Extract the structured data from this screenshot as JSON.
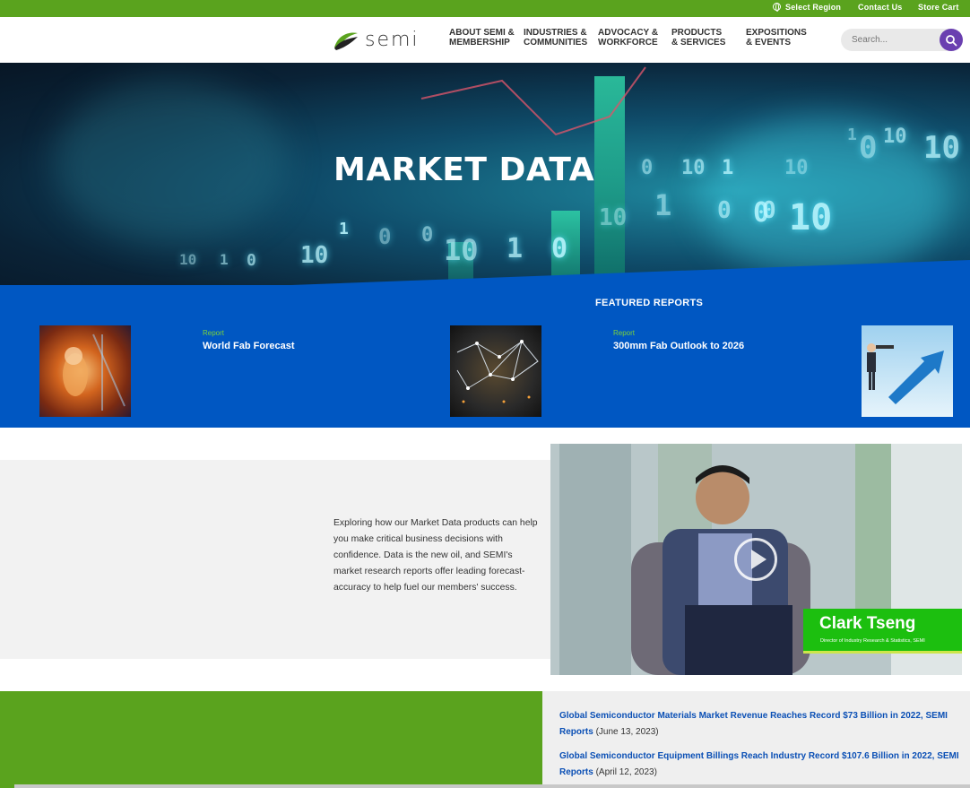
{
  "utility": {
    "select_region": "Select Region",
    "contact_us": "Contact Us",
    "store_cart": "Store Cart"
  },
  "header": {
    "logo_text": "semi",
    "nav": [
      {
        "line1": "ABOUT SEMI &",
        "line2": "MEMBERSHIP"
      },
      {
        "line1": "INDUSTRIES &",
        "line2": "COMMUNITIES"
      },
      {
        "line1": "ADVOCACY &",
        "line2": "WORKFORCE"
      },
      {
        "line1": "PRODUCTS",
        "line2": "& SERVICES"
      },
      {
        "line1": "EXPOSITIONS",
        "line2": "& EVENTS"
      }
    ],
    "search_placeholder": "Search..."
  },
  "hero": {
    "title": "MARKET DATA"
  },
  "featured": {
    "title": "FEATURED REPORTS",
    "reports": [
      {
        "tag": "Report",
        "title": "World Fab Forecast"
      },
      {
        "tag": "Report",
        "title": "300mm Fab Outlook to 2026"
      }
    ]
  },
  "intro": {
    "text": "Exploring how our Market Data products can help you make critical business decisions with confidence. Data is the new oil, and SEMI's market research reports offer leading forecast-accuracy to help fuel our members' success."
  },
  "video": {
    "name": "Clark Tseng",
    "role": "Director of Industry Research & Statistics, SEMI"
  },
  "news": [
    {
      "title": "Global Semiconductor Materials Market Revenue Reaches Record $73 Billion in 2022, SEMI Reports",
      "date": "(June 13, 2023)"
    },
    {
      "title": "Global Semiconductor Equipment Billings Reach Industry Record $107.6 Billion in 2022, SEMI Reports",
      "date": "(April 12, 2023)"
    }
  ],
  "colors": {
    "brand_green": "#5aa31e",
    "featured_blue": "#0057c2",
    "search_purple": "#6a3fb0",
    "link_blue": "#0a4fb5"
  },
  "hero_digits": [
    "10",
    "1",
    "0",
    "10",
    "1",
    "0",
    "0",
    "10",
    "1",
    "0",
    "10",
    "0",
    "10",
    "1",
    "0",
    "10",
    "1",
    "0",
    "0",
    "10",
    "1",
    "0",
    "10",
    "10"
  ]
}
